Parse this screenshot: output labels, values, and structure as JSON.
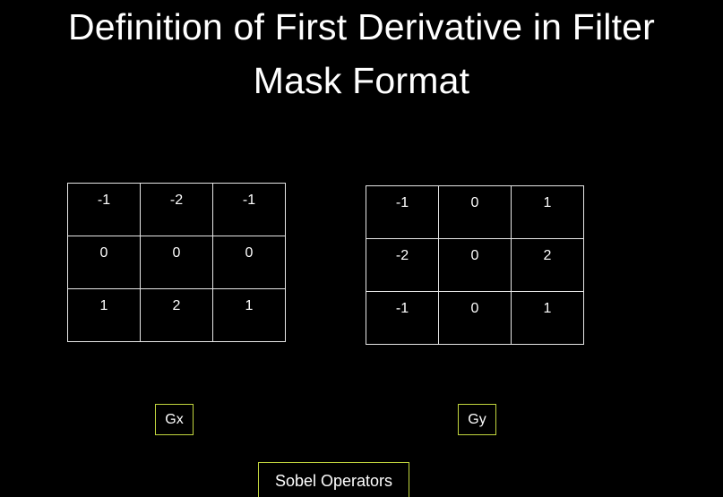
{
  "slide": {
    "title_line1": "Definition of First Derivative in Filter",
    "title_line2": "Mask Format",
    "colors": {
      "background": "#000000",
      "text": "#ffffff",
      "label_border": "#c2d63e"
    }
  },
  "gx": {
    "label": "Gx",
    "rows": [
      [
        "-1",
        "-2",
        "-1"
      ],
      [
        "0",
        "0",
        "0"
      ],
      [
        "1",
        "2",
        "1"
      ]
    ]
  },
  "gy": {
    "label": "Gy",
    "rows": [
      [
        "-1",
        "0",
        "1"
      ],
      [
        "-2",
        "0",
        "2"
      ],
      [
        "-1",
        "0",
        "1"
      ]
    ]
  },
  "caption": "Sobel Operators"
}
